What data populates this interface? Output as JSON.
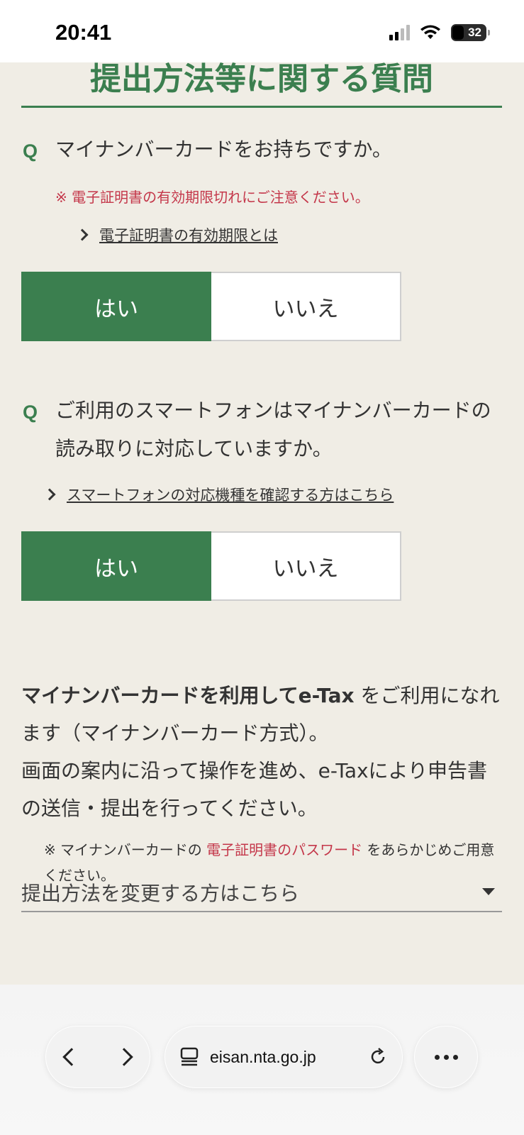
{
  "status": {
    "time": "20:41",
    "battery": "32"
  },
  "page": {
    "section_title": "提出方法等に関する質問",
    "q1": {
      "label": "Q",
      "text": "マイナンバーカードをお持ちですか。",
      "note": "※ 電子証明書の有効期限切れにご注意ください。",
      "link": "電子証明書の有効期限とは",
      "yes": "はい",
      "no": "いいえ",
      "selected": "はい"
    },
    "q2": {
      "label": "Q",
      "text": "ご利用のスマートフォンはマイナンバーカードの読み取りに対応していますか。",
      "link": "スマートフォンの対応機種を確認する方はこちら",
      "yes": "はい",
      "no": "いいえ",
      "selected": "はい"
    },
    "result": {
      "bold": "マイナンバーカードを利用してe-Tax",
      "text1": " をご利用になれます（マイナンバーカード方式）。",
      "text2": "画面の案内に沿って操作を進め、e-Taxにより申告書の送信・提出を行ってください。"
    },
    "note": {
      "prefix": "※ マイナンバーカードの ",
      "red": "電子証明書のパスワード",
      "suffix": " をあらかじめご用意ください。"
    },
    "change_link": "提出方法を変更する方はこちら"
  },
  "browser": {
    "url": "eisan.nta.go.jp",
    "icons": [
      "back-icon",
      "forward-icon",
      "tabs-icon",
      "reload-icon",
      "more-icon"
    ]
  },
  "colors": {
    "accent": "#3b7f4f",
    "red": "#c4374a",
    "background": "#f0ede5"
  }
}
